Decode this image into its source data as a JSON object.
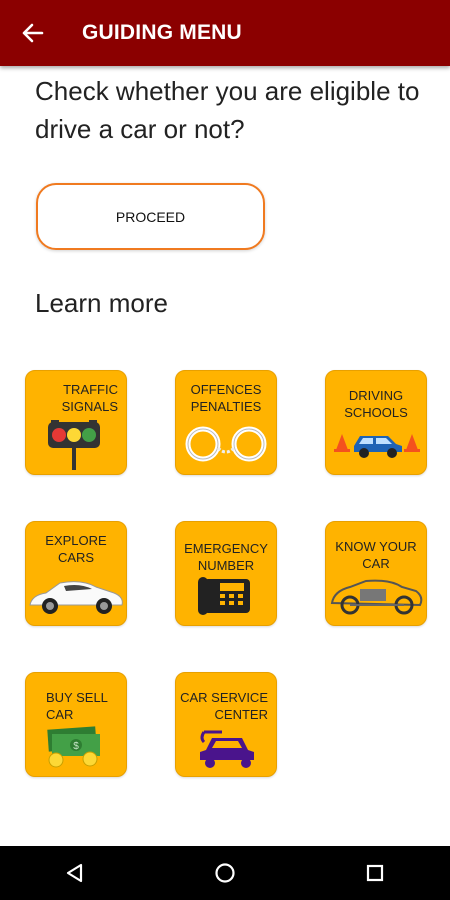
{
  "appbar": {
    "title": "GUIDING MENU",
    "back_icon": "arrow-left-icon",
    "color": "#8b0000"
  },
  "eligibility": {
    "question": "Check whether you are eligible to drive a car or not?",
    "proceed_label": "PROCEED"
  },
  "learn_more": {
    "heading": "Learn more"
  },
  "tiles": [
    {
      "label": "TRAFFIC\nSIGNALS",
      "icon": "traffic-light-icon"
    },
    {
      "label": "OFFENCES\nPENALTIES",
      "icon": "handcuffs-icon"
    },
    {
      "label": "DRIVING\nSCHOOLS",
      "icon": "training-car-icon"
    },
    {
      "label": "EXPLORE\nCARS",
      "icon": "sports-car-icon"
    },
    {
      "label": "EMERGENCY\nNUMBER",
      "icon": "telephone-icon"
    },
    {
      "label": "KNOW YOUR\nCAR",
      "icon": "car-parts-icon"
    },
    {
      "label": "BUY SELL\nCAR",
      "icon": "cash-icon"
    },
    {
      "label": "CAR SERVICE\nCENTER",
      "icon": "car-service-icon"
    }
  ],
  "tile_color": "#ffb300",
  "accent_color": "#f07a20",
  "navbar": {
    "back": "back-triangle-icon",
    "home": "home-circle-icon",
    "recents": "recents-square-icon"
  }
}
